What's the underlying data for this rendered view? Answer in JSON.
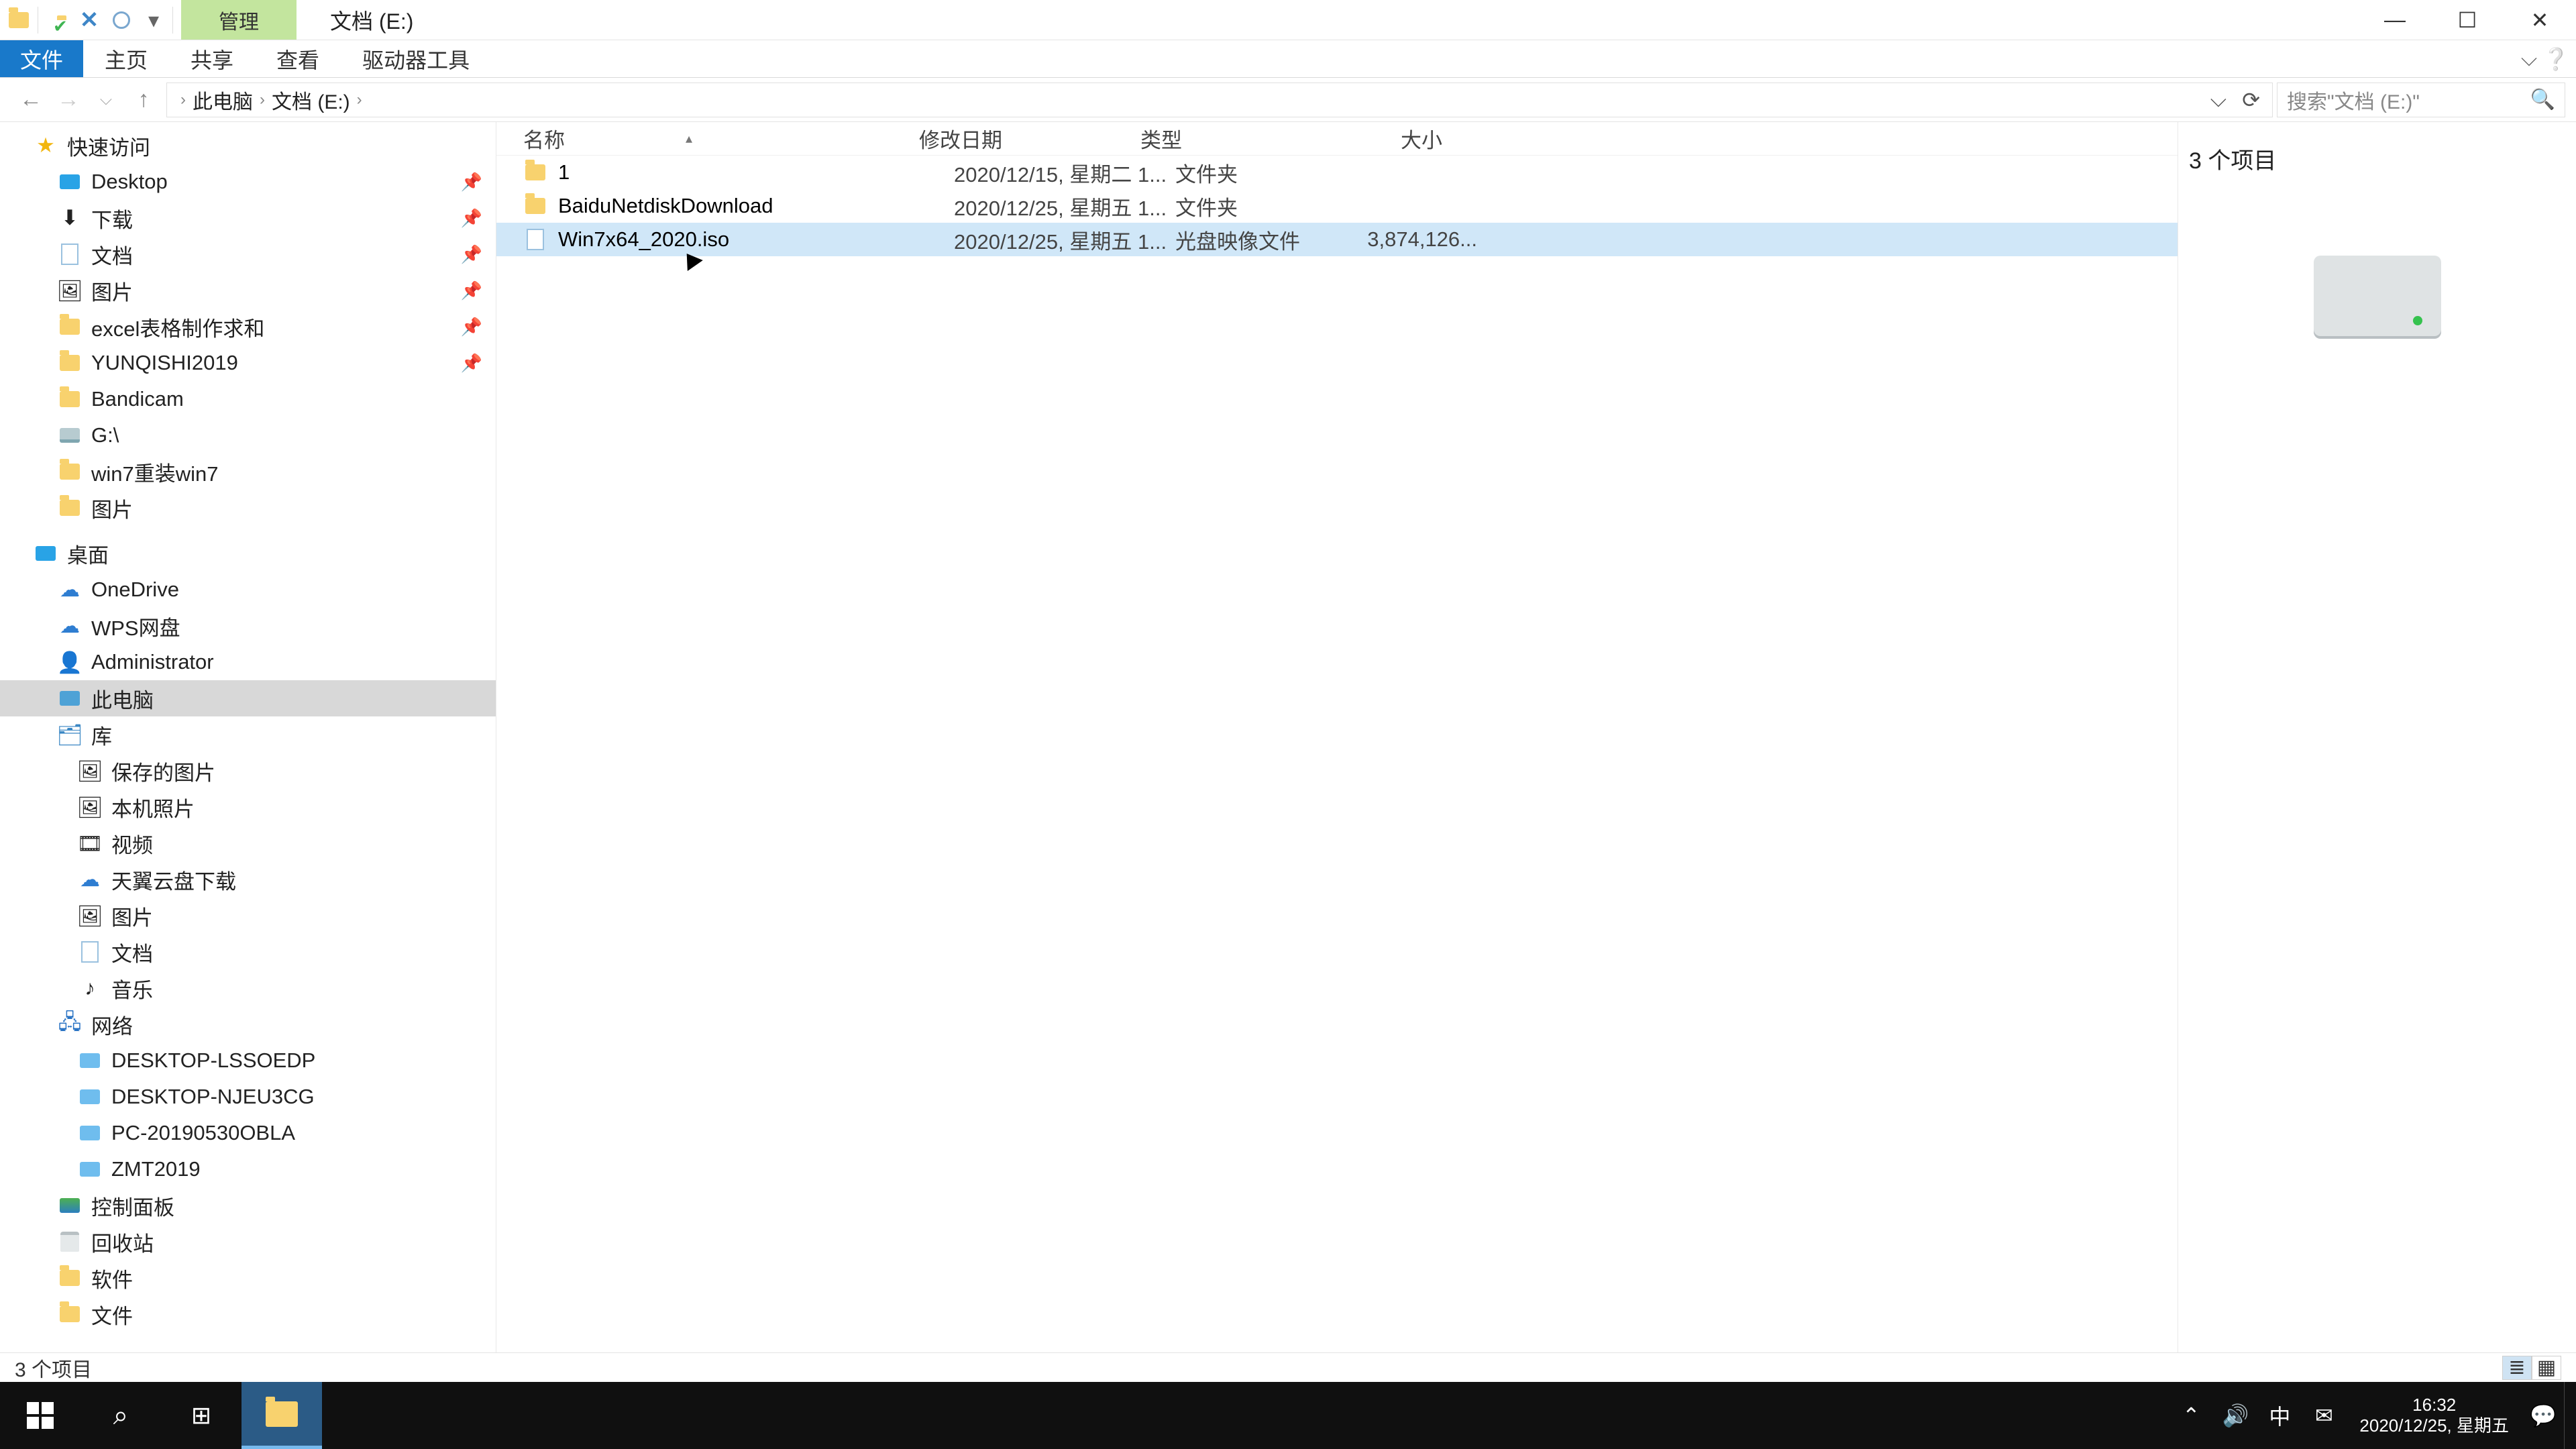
{
  "titlebar": {
    "contextual_tab": "管理",
    "title": "文档 (E:)"
  },
  "ribbon": {
    "file": "文件",
    "home": "主页",
    "share": "共享",
    "view": "查看",
    "drive_tools": "驱动器工具"
  },
  "breadcrumbs": {
    "thispc": "此电脑",
    "drive": "文档 (E:)"
  },
  "search": {
    "placeholder": "搜索\"文档 (E:)\""
  },
  "nav": {
    "quick_access": "快速访问",
    "desktop": "Desktop",
    "downloads": "下载",
    "documents": "文档",
    "pictures": "图片",
    "excel": "excel表格制作求和",
    "yunqishi": "YUNQISHI2019",
    "bandicam": "Bandicam",
    "gdrive": "G:\\",
    "win7": "win7重装win7",
    "pics2": "图片",
    "desktop_cn": "桌面",
    "onedrive": "OneDrive",
    "wps": "WPS网盘",
    "admin": "Administrator",
    "thispc": "此电脑",
    "libraries": "库",
    "saved_pics": "保存的图片",
    "camera_roll": "本机照片",
    "videos": "视频",
    "tianyi": "天翼云盘下载",
    "lib_pics": "图片",
    "lib_docs": "文档",
    "lib_music": "音乐",
    "network": "网络",
    "pc1": "DESKTOP-LSSOEDP",
    "pc2": "DESKTOP-NJEU3CG",
    "pc3": "PC-20190530OBLA",
    "pc4": "ZMT2019",
    "control_panel": "控制面板",
    "recycle": "回收站",
    "soft": "软件",
    "files": "文件"
  },
  "columns": {
    "name": "名称",
    "date": "修改日期",
    "type": "类型",
    "size": "大小"
  },
  "files": [
    {
      "name": "1",
      "date": "2020/12/15, 星期二 1...",
      "type": "文件夹",
      "size": "",
      "icon": "folder"
    },
    {
      "name": "BaiduNetdiskDownload",
      "date": "2020/12/25, 星期五 1...",
      "type": "文件夹",
      "size": "",
      "icon": "folder"
    },
    {
      "name": "Win7x64_2020.iso",
      "date": "2020/12/25, 星期五 1...",
      "type": "光盘映像文件",
      "size": "3,874,126...",
      "icon": "iso",
      "selected": true
    }
  ],
  "preview": {
    "count_label": "3 个项目"
  },
  "status": {
    "text": "3 个项目"
  },
  "tray": {
    "ime": "中",
    "time": "16:32",
    "date": "2020/12/25, 星期五"
  }
}
